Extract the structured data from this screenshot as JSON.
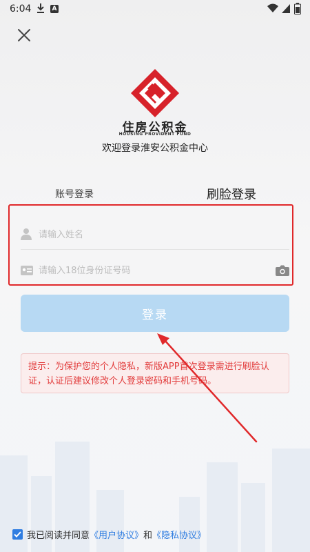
{
  "status_bar": {
    "time": "6:04",
    "icons": [
      "download-icon",
      "font-icon",
      "wifi-icon",
      "signal-icon",
      "battery-icon"
    ]
  },
  "close_icon": "close-icon",
  "logo": {
    "name": "住房公积金",
    "english": "HOUSING PROVIDENT FUND",
    "brand_color": "#d7222a"
  },
  "welcome": "欢迎登录淮安公积金中心",
  "tabs": [
    {
      "label": "账号登录",
      "active": false
    },
    {
      "label": "刷脸登录",
      "active": true
    }
  ],
  "form": {
    "name_placeholder": "请输入姓名",
    "name_value": "",
    "id_placeholder": "请输入18位身份证号码",
    "id_value": "",
    "icons": [
      "user-icon",
      "id-card-icon",
      "camera-icon"
    ]
  },
  "login_button": "登录",
  "notice": "提示：为保护您的个人隐私，新版APP首次登录需进行刷脸认证，认证后建议修改个人登录密码和手机号码。",
  "agreement": {
    "checked": true,
    "prefix": "我已阅读并同意",
    "user_agreement": "《用户协议》",
    "and": "和",
    "privacy_agreement": "《隐私协议》"
  },
  "colors": {
    "accent": "#2f7de1",
    "button": "#b7d9f3",
    "highlight": "#e0282a",
    "notice_text": "#e23a3a"
  }
}
